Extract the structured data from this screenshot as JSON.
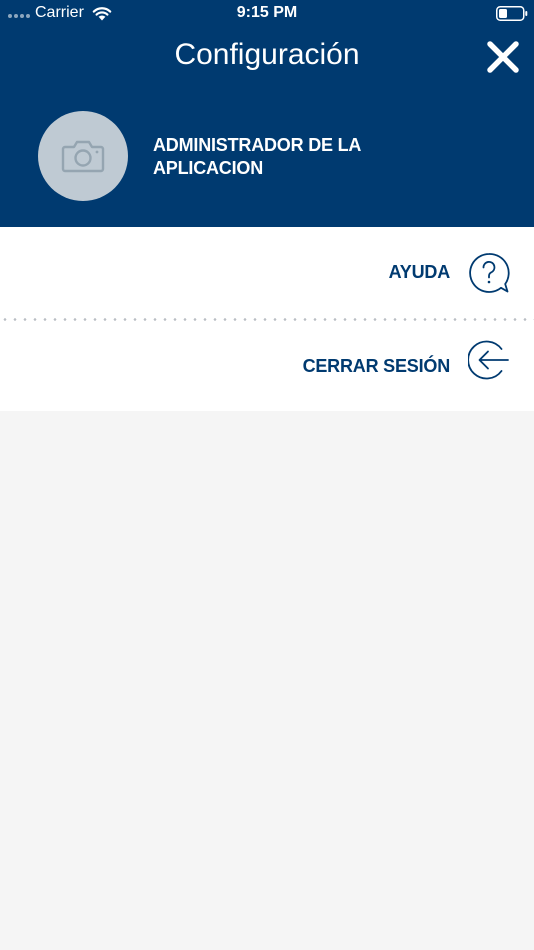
{
  "status_bar": {
    "carrier": "Carrier",
    "time": "9:15 PM"
  },
  "header": {
    "title": "Configuración",
    "close_icon": "close-icon"
  },
  "profile": {
    "avatar_icon": "camera-icon",
    "name": "ADMINISTRADOR DE LA APLICACION"
  },
  "menu": {
    "items": [
      {
        "label": "AYUDA",
        "icon": "help-bubble-icon"
      },
      {
        "label": "CERRAR SESIÓN",
        "icon": "logout-arrow-icon"
      }
    ]
  },
  "colors": {
    "primary": "#003a70",
    "avatar_bg": "#bfcad3",
    "background": "#f5f5f5",
    "menu_bg": "#ffffff"
  }
}
